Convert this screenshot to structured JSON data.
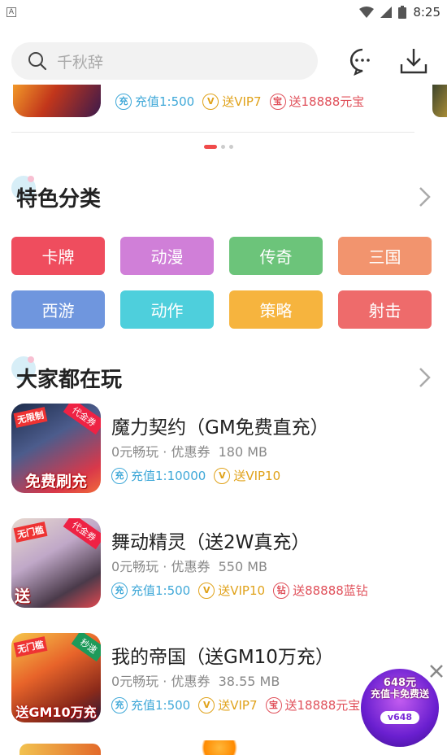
{
  "status": {
    "left_icon": "A",
    "time": "8:25"
  },
  "search": {
    "placeholder": "千秋辞"
  },
  "banner": {
    "tags": [
      {
        "icon": "充",
        "text": "充值1:500",
        "color": "blue"
      },
      {
        "icon": "V",
        "text": "送VIP7",
        "color": "gold"
      },
      {
        "icon": "宝",
        "text": "送18888元宝",
        "color": "red"
      }
    ],
    "pages": 3,
    "active_page": 1
  },
  "categories_section": {
    "title": "特色分类",
    "items": [
      {
        "label": "卡牌",
        "color": "#ef4d5e"
      },
      {
        "label": "动漫",
        "color": "#d07fd8"
      },
      {
        "label": "传奇",
        "color": "#6cc47a"
      },
      {
        "label": "三国",
        "color": "#f2946e"
      },
      {
        "label": "西游",
        "color": "#6f96de"
      },
      {
        "label": "动作",
        "color": "#4ecfdc"
      },
      {
        "label": "策略",
        "color": "#f6b43e"
      },
      {
        "label": "射击",
        "color": "#ee6b6b"
      }
    ]
  },
  "popular_section": {
    "title": "大家都在玩",
    "games": [
      {
        "name": "魔力契约（GM免费直充）",
        "meta": "0元畅玩 · 优惠券",
        "size": "180 MB",
        "thumb": {
          "ribbon": "无限制",
          "corner": "代金券",
          "bottom": "免费刷充"
        },
        "tags": [
          {
            "icon": "充",
            "text": "充值1:10000",
            "color": "blue"
          },
          {
            "icon": "V",
            "text": "送VIP10",
            "color": "gold"
          }
        ]
      },
      {
        "name": "舞动精灵（送2W真充）",
        "meta": "0元畅玩 · 优惠券",
        "size": "550 MB",
        "thumb": {
          "ribbon": "无门槛",
          "corner": "代金券",
          "bottom": "送"
        },
        "tags": [
          {
            "icon": "充",
            "text": "充值1:500",
            "color": "blue"
          },
          {
            "icon": "V",
            "text": "送VIP10",
            "color": "gold"
          },
          {
            "icon": "钻",
            "text": "送88888蓝钻",
            "color": "red"
          }
        ]
      },
      {
        "name": "我的帝国（送GM10万充）",
        "meta": "0元畅玩 · 优惠券",
        "size": "38.55 MB",
        "thumb": {
          "ribbon": "无门槛",
          "corner": "秒速",
          "bottom": "送GM10万充"
        },
        "tags": [
          {
            "icon": "充",
            "text": "充值1:500",
            "color": "blue"
          },
          {
            "icon": "V",
            "text": "送VIP7",
            "color": "gold"
          },
          {
            "icon": "宝",
            "text": "送18888元宝",
            "color": "red"
          }
        ]
      }
    ]
  },
  "float_ad": {
    "line1": "648元",
    "line2": "充值卡免费送",
    "line3": "v648"
  }
}
